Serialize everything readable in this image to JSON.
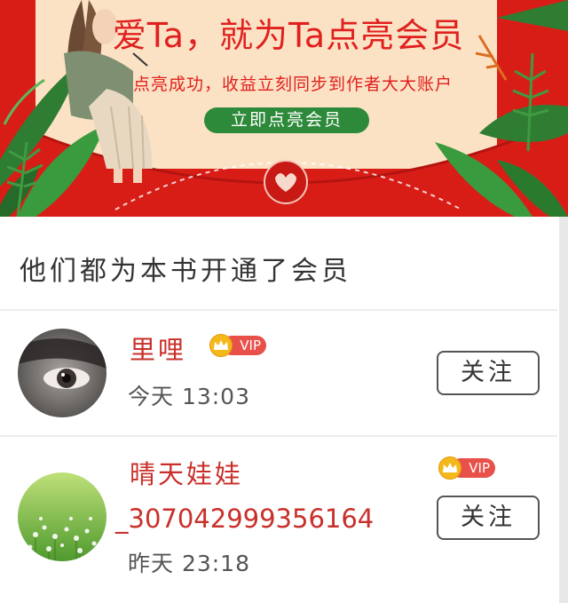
{
  "banner": {
    "title": "爱Ta，就为Ta点亮会员",
    "subtitle": "点亮成功，收益立刻同步到作者大大账户",
    "cta_label": "立即点亮会员"
  },
  "section": {
    "title": "他们都为本书开通了会员"
  },
  "members": [
    {
      "name": "里哩",
      "badge": "VIP",
      "time": "今天 13:03",
      "follow_label": "关注"
    },
    {
      "name_line1": "晴天娃娃",
      "name_line2": "_307042999356164",
      "badge": "VIP",
      "time": "昨天 23:18",
      "follow_label": "关注"
    }
  ],
  "colors": {
    "banner_red": "#d81d17",
    "banner_inner": "#fce2c4",
    "cta_green": "#2e8a3b",
    "name_red": "#c9302a",
    "vip_pill": "#e8514a",
    "crown_gold": "#f5b81a"
  }
}
